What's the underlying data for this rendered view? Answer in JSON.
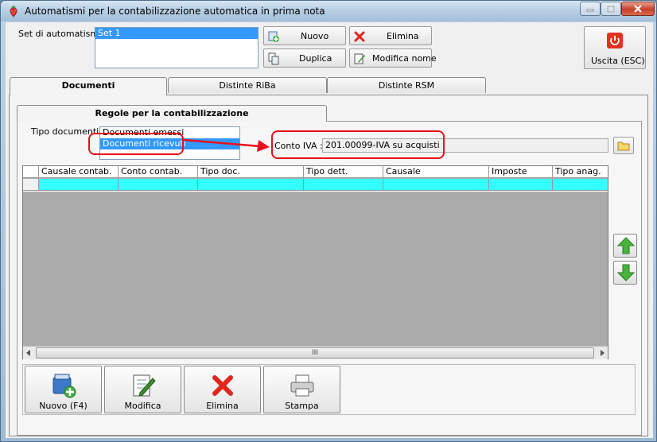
{
  "window": {
    "title": "Automatismi per la contabilizzazione automatica in prima nota"
  },
  "set": {
    "label": "Set di automatismi :",
    "items": [
      "Set 1"
    ]
  },
  "toolbar": {
    "nuovo": "Nuovo",
    "elimina": "Elimina",
    "duplica": "Duplica",
    "modifica_nome": "Modifica nome",
    "uscita": "Uscita (ESC)"
  },
  "tabs": [
    {
      "label": "Documenti",
      "active": true
    },
    {
      "label": "Distinte RiBa",
      "active": false
    },
    {
      "label": "Distinte RSM",
      "active": false
    }
  ],
  "panel": {
    "title": "Regole per la contabilizzazione",
    "tipo_documenti_label": "Tipo documenti :",
    "tipo_documenti_items": [
      "Documenti emessi",
      "Documenti ricevuti"
    ],
    "selected_tipo": "Documenti ricevuti",
    "conto_iva_label": "Conto IVA :",
    "conto_iva_value": "201.00099-IVA su acquisti"
  },
  "grid": {
    "columns": [
      "Causale contab.",
      "Conto contab.",
      "Tipo doc.",
      "Tipo dett.",
      "Causale",
      "Imposte",
      "Tipo anag."
    ],
    "scroll_thumb": "III"
  },
  "bottom_buttons": {
    "nuovo": "Nuovo (F4)",
    "modifica": "Modifica",
    "elimina": "Elimina",
    "stampa": "Stampa"
  },
  "colors": {
    "selection": "#3399ff",
    "grid_row": "#33ffff",
    "grid_bg": "#ababab",
    "annotation": "#e8101c"
  }
}
